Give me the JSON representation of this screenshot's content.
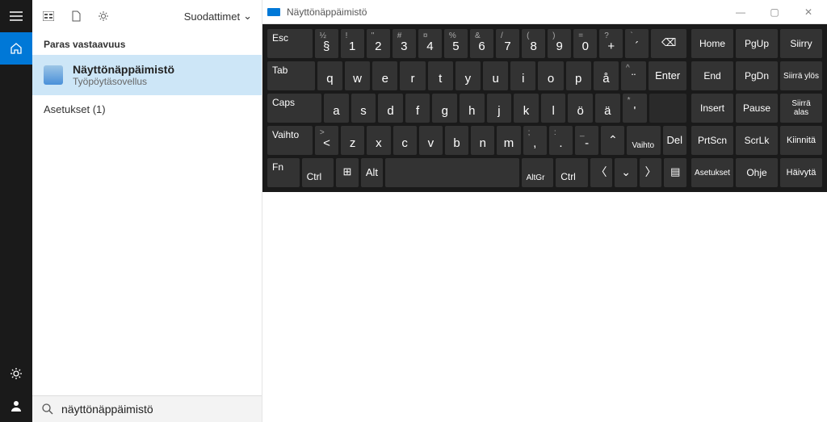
{
  "rail": {
    "hamburger": "≡",
    "home": "⌂",
    "gear": "⚙",
    "user": "👤"
  },
  "panel": {
    "filters_label": "Suodattimet",
    "section_best": "Paras vastaavuus",
    "result": {
      "title": "Näyttönäppäimistö",
      "subtitle": "Työpöytäsovellus"
    },
    "settings_label": "Asetukset (1)",
    "search_value": "näyttönäppäimistö"
  },
  "osk": {
    "title": "Näyttönäppäimistö",
    "win": {
      "min": "—",
      "max": "▢",
      "close": "✕"
    },
    "rows": {
      "r1": {
        "esc": "Esc",
        "keys": [
          {
            "s": "½",
            "m": "§"
          },
          {
            "s": "!",
            "m": "1"
          },
          {
            "s": "\"",
            "m": "2"
          },
          {
            "s": "#",
            "m": "3"
          },
          {
            "s": "¤",
            "m": "4"
          },
          {
            "s": "%",
            "m": "5"
          },
          {
            "s": "&",
            "m": "6"
          },
          {
            "s": "/",
            "m": "7"
          },
          {
            "s": "(",
            "m": "8"
          },
          {
            "s": ")",
            "m": "9"
          },
          {
            "s": "=",
            "m": "0"
          },
          {
            "s": "?",
            "m": "+"
          },
          {
            "s": "`",
            "m": "´"
          }
        ],
        "bksp": "⌫"
      },
      "r2": {
        "tab": "Tab",
        "keys": [
          "q",
          "w",
          "e",
          "r",
          "t",
          "y",
          "u",
          "i",
          "o",
          "p",
          "å"
        ],
        "brkt": {
          "s": "^",
          "m": "¨"
        },
        "enter": "Enter"
      },
      "r3": {
        "caps": "Caps",
        "keys": [
          "a",
          "s",
          "d",
          "f",
          "g",
          "h",
          "j",
          "k",
          "l",
          "ö",
          "ä"
        ],
        "quote": {
          "s": "*",
          "m": "'"
        }
      },
      "r4": {
        "shift": "Vaihto",
        "lt": {
          "s": ">",
          "m": "<"
        },
        "keys": [
          "z",
          "x",
          "c",
          "v",
          "b",
          "n",
          "m"
        ],
        "comma": {
          "s": ";",
          "m": ","
        },
        "period": {
          "s": ":",
          "m": "."
        },
        "dash": {
          "s": "_",
          "m": "-"
        },
        "up": "⌃",
        "rshift": "Vaihto",
        "del": "Del"
      },
      "r5": {
        "fn": "Fn",
        "lctrl": "Ctrl",
        "win": "⊞",
        "alt": "Alt",
        "altgr": "AltGr",
        "rctrl": "Ctrl",
        "left": "〈",
        "down": "⌄",
        "right": "〉",
        "menu": "▤"
      }
    },
    "side": {
      "r1": [
        "Home",
        "PgUp",
        "Siirry"
      ],
      "r2": [
        "End",
        "PgDn",
        "Siirrä ylös"
      ],
      "r3": [
        "Insert",
        "Pause",
        "Siirrä alas"
      ],
      "r4": [
        "PrtScn",
        "ScrLk",
        "Kiinnitä"
      ],
      "r5": [
        "Asetukset",
        "Ohje",
        "Häivytä"
      ]
    }
  }
}
